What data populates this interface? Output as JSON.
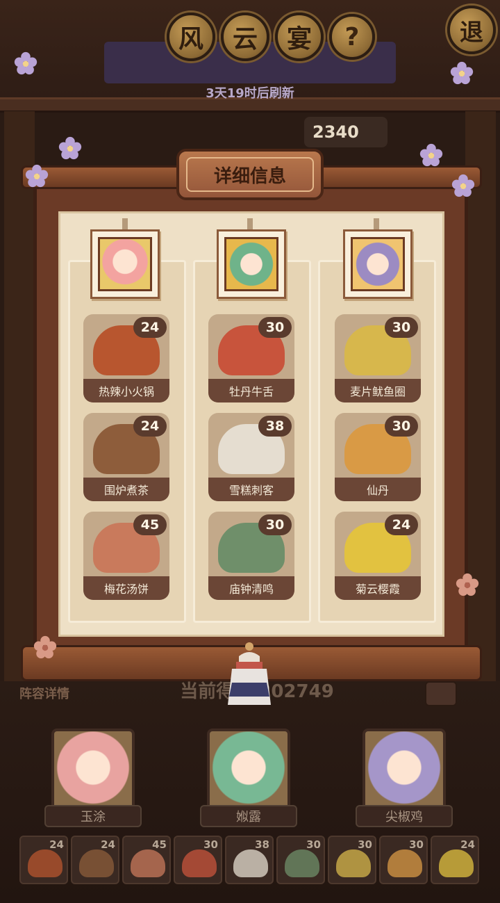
{
  "header": {
    "title_chars": [
      "风",
      "云",
      "宴"
    ],
    "help_symbol": "?",
    "exit_label": "退",
    "refresh_text": "3天19时后刷新",
    "top_score_partial": "2340"
  },
  "panel": {
    "title": "详细信息",
    "columns": [
      {
        "portrait_color": "#f3a3a0",
        "dishes": [
          {
            "name": "热辣小火锅",
            "count": "24",
            "color": "#b8562f"
          },
          {
            "name": "围炉煮茶",
            "count": "24",
            "color": "#8e5d3b"
          },
          {
            "name": "梅花汤饼",
            "count": "45",
            "color": "#c97a5c"
          }
        ]
      },
      {
        "portrait_color": "#6fb38a",
        "dishes": [
          {
            "name": "牡丹牛舌",
            "count": "30",
            "color": "#c8543c"
          },
          {
            "name": "雪糕刺客",
            "count": "38",
            "color": "#e5ddd0"
          },
          {
            "name": "庙钟清鸣",
            "count": "30",
            "color": "#6f8f6a"
          }
        ]
      },
      {
        "portrait_color": "#9c8bc2",
        "dishes": [
          {
            "name": "麦片鱿鱼圈",
            "count": "30",
            "color": "#d7b74c"
          },
          {
            "name": "仙丹",
            "count": "30",
            "color": "#d99a45"
          },
          {
            "name": "菊云樱霞",
            "count": "24",
            "color": "#e2c240"
          }
        ]
      }
    ]
  },
  "lineup": {
    "label": "阵容详情",
    "score_text": "当前得分 202749",
    "characters": [
      {
        "name": "玉涂",
        "color": "#e8a3a0"
      },
      {
        "name": "娰露",
        "color": "#78b894"
      },
      {
        "name": "尖椒鸡",
        "color": "#a596c9"
      }
    ],
    "mini_dishes": [
      {
        "count": "24",
        "color": "#b8562f"
      },
      {
        "count": "24",
        "color": "#8e5d3b"
      },
      {
        "count": "45",
        "color": "#c97a5c"
      },
      {
        "count": "30",
        "color": "#c8543c"
      },
      {
        "count": "38",
        "color": "#e5ddd0"
      },
      {
        "count": "30",
        "color": "#6f8f6a"
      },
      {
        "count": "30",
        "color": "#d7b74c"
      },
      {
        "count": "30",
        "color": "#d99a45"
      },
      {
        "count": "24",
        "color": "#e2c240"
      }
    ]
  }
}
